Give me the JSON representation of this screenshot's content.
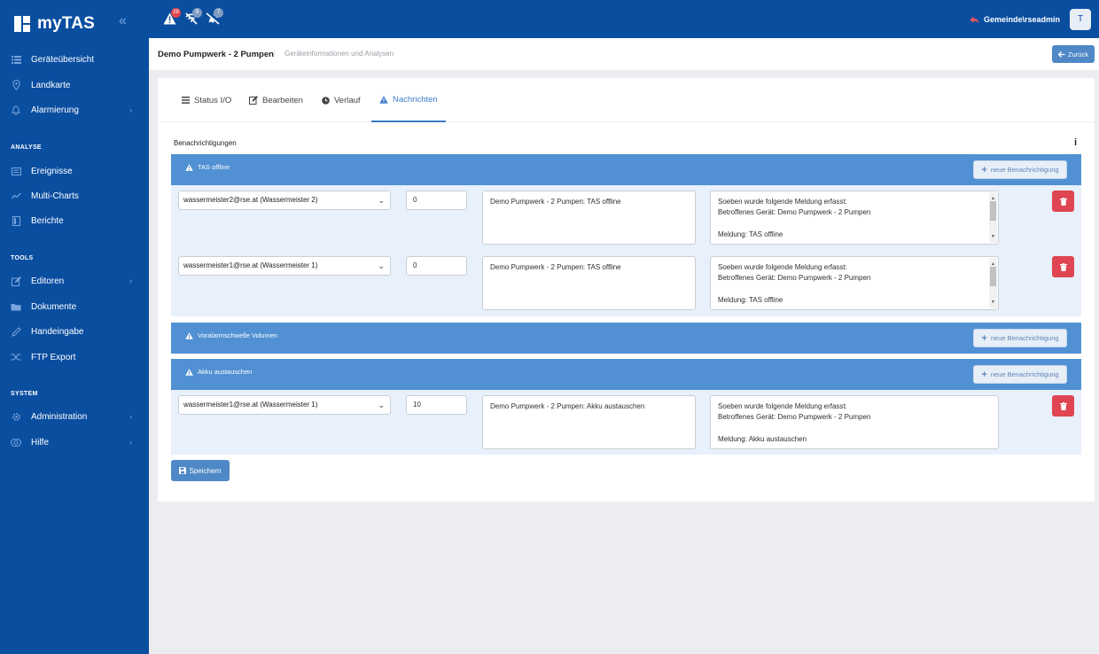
{
  "app": {
    "name": "myTAS"
  },
  "topbar": {
    "alerts": [
      {
        "icon": "warning-icon",
        "count": "28",
        "color": "#e04552"
      },
      {
        "icon": "signal-off-icon",
        "count": "8",
        "color": "#7f9bc0"
      },
      {
        "icon": "plug-off-icon",
        "count": "7",
        "color": "#7f9bc0"
      }
    ],
    "user": "Gemeinde\\rseadmin",
    "avatar": "T"
  },
  "sidebar": {
    "items": [
      {
        "label": "Geräteübersicht",
        "icon": "list-icon"
      },
      {
        "label": "Landkarte",
        "icon": "map-pin-icon"
      },
      {
        "label": "Alarmierung",
        "icon": "bell-icon"
      }
    ],
    "sections": [
      {
        "title": "ANALYSE",
        "items": [
          {
            "label": "Ereignisse",
            "icon": "events-icon"
          },
          {
            "label": "Multi-Charts",
            "icon": "chart-icon"
          },
          {
            "label": "Berichte",
            "icon": "report-icon"
          }
        ]
      },
      {
        "title": "TOOLS",
        "items": [
          {
            "label": "Editoren",
            "icon": "edit-icon"
          },
          {
            "label": "Dokumente",
            "icon": "folder-icon"
          },
          {
            "label": "Handeingabe",
            "icon": "pencil-icon"
          },
          {
            "label": "FTP Export",
            "icon": "shuffle-icon"
          }
        ]
      },
      {
        "title": "SYSTEM",
        "items": [
          {
            "label": "Administration",
            "icon": "gear-icon"
          },
          {
            "label": "Hilfe",
            "icon": "lifebuoy-icon"
          }
        ]
      }
    ]
  },
  "header": {
    "title": "Demo Pumpwerk - 2 Pumpen",
    "subtitle": "Geräteinformationen und Analysen",
    "back_label": "Zurück"
  },
  "tabs": [
    {
      "label": "Status I/O",
      "icon": "list-icon"
    },
    {
      "label": "Bearbeiten",
      "icon": "edit-icon"
    },
    {
      "label": "Verlauf",
      "icon": "clock-icon"
    },
    {
      "label": "Nachrichten",
      "icon": "warning-icon"
    }
  ],
  "notifications": {
    "title": "Benachrichtigungen",
    "new_label": "neue Benachrichtigung",
    "groups": [
      {
        "name": "TAS offline",
        "rows": [
          {
            "recipient": "wassermeister2@rse.at (Wassermeister 2)",
            "delay": "0",
            "subject": "Demo Pumpwerk - 2 Pumpen: TAS offline",
            "body": "Soeben wurde folgende Meldung erfasst:\nBetroffenes Gerät: Demo Pumpwerk - 2 Pumpen\n\nMeldung: TAS offline"
          },
          {
            "recipient": "wassermeister1@rse.at (Wassermeister 1)",
            "delay": "0",
            "subject": "Demo Pumpwerk - 2 Pumpen: TAS offline",
            "body": "Soeben wurde folgende Meldung erfasst:\nBetroffenes Gerät: Demo Pumpwerk - 2 Pumpen\n\nMeldung: TAS offline"
          }
        ]
      },
      {
        "name": "Voralarmschwelle Volumen",
        "rows": []
      },
      {
        "name": "Akku austauschen",
        "rows": [
          {
            "recipient": "wassermeister1@rse.at (Wassermeister 1)",
            "delay": "10",
            "subject": "Demo Pumpwerk - 2 Pumpen: Akku austauschen",
            "body": "Soeben wurde folgende Meldung erfasst:\nBetroffenes Gerät: Demo Pumpwerk - 2 Pumpen\n\nMeldung: Akku austauschen"
          }
        ]
      }
    ]
  },
  "save_label": "Speichern",
  "colors": {
    "primary": "#0a4ea0",
    "accent": "#4f88c6",
    "group_header": "#5191d3",
    "danger": "#e04552"
  }
}
